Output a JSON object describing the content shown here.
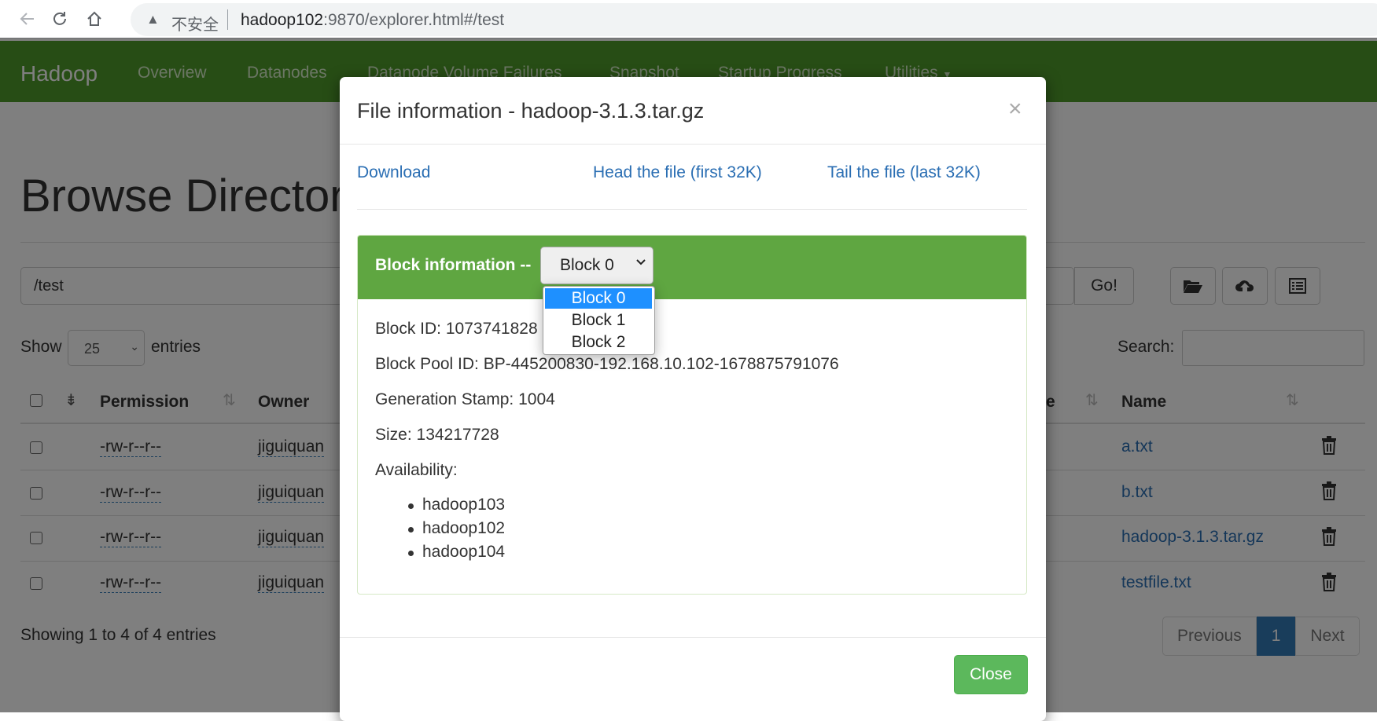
{
  "browser": {
    "insecure_label": "不安全",
    "url_host": "hadoop102",
    "url_rest": ":9870/explorer.html#/test"
  },
  "navbar": {
    "brand": "Hadoop",
    "items": [
      "Overview",
      "Datanodes",
      "Datanode Volume Failures",
      "Snapshot",
      "Startup Progress",
      "Utilities"
    ]
  },
  "page": {
    "title": "Browse Directory",
    "path_value": "/test",
    "go_label": "Go!",
    "show_label": "Show",
    "entries_value": "25",
    "entries_label": "entries",
    "search_label": "Search:",
    "columns": [
      "Permission",
      "Owner",
      "e",
      "Name"
    ],
    "rows": [
      {
        "permission": "-rw-r--r--",
        "owner": "jiguiquan",
        "name": "a.txt"
      },
      {
        "permission": "-rw-r--r--",
        "owner": "jiguiquan",
        "name": "b.txt"
      },
      {
        "permission": "-rw-r--r--",
        "owner": "jiguiquan",
        "name": "hadoop-3.1.3.tar.gz"
      },
      {
        "permission": "-rw-r--r--",
        "owner": "jiguiquan",
        "name": "testfile.txt"
      }
    ],
    "showing": "Showing 1 to 4 of 4 entries",
    "pager": {
      "previous": "Previous",
      "current": "1",
      "next": "Next"
    }
  },
  "modal": {
    "title": "File information - hadoop-3.1.3.tar.gz",
    "close_x": "×",
    "links": {
      "download": "Download",
      "head": "Head the file (first 32K)",
      "tail": "Tail the file (last 32K)"
    },
    "block_label": "Block information --",
    "block_selected": "Block 0",
    "block_options": [
      "Block 0",
      "Block 1",
      "Block 2"
    ],
    "block_id": "Block ID: 1073741828",
    "pool_id": "Block Pool ID: BP-445200830-192.168.10.102-1678875791076",
    "gen_stamp": "Generation Stamp: 1004",
    "size": "Size: 134217728",
    "availability_label": "Availability:",
    "hosts": [
      "hadoop103",
      "hadoop102",
      "hadoop104"
    ],
    "close_label": "Close"
  },
  "colors": {
    "navbar": "#4e9a2a",
    "panel_head": "#5fa641",
    "link": "#2a6eb3",
    "close_button": "#5cb85c",
    "dropdown_selected": "#1e90ff"
  }
}
